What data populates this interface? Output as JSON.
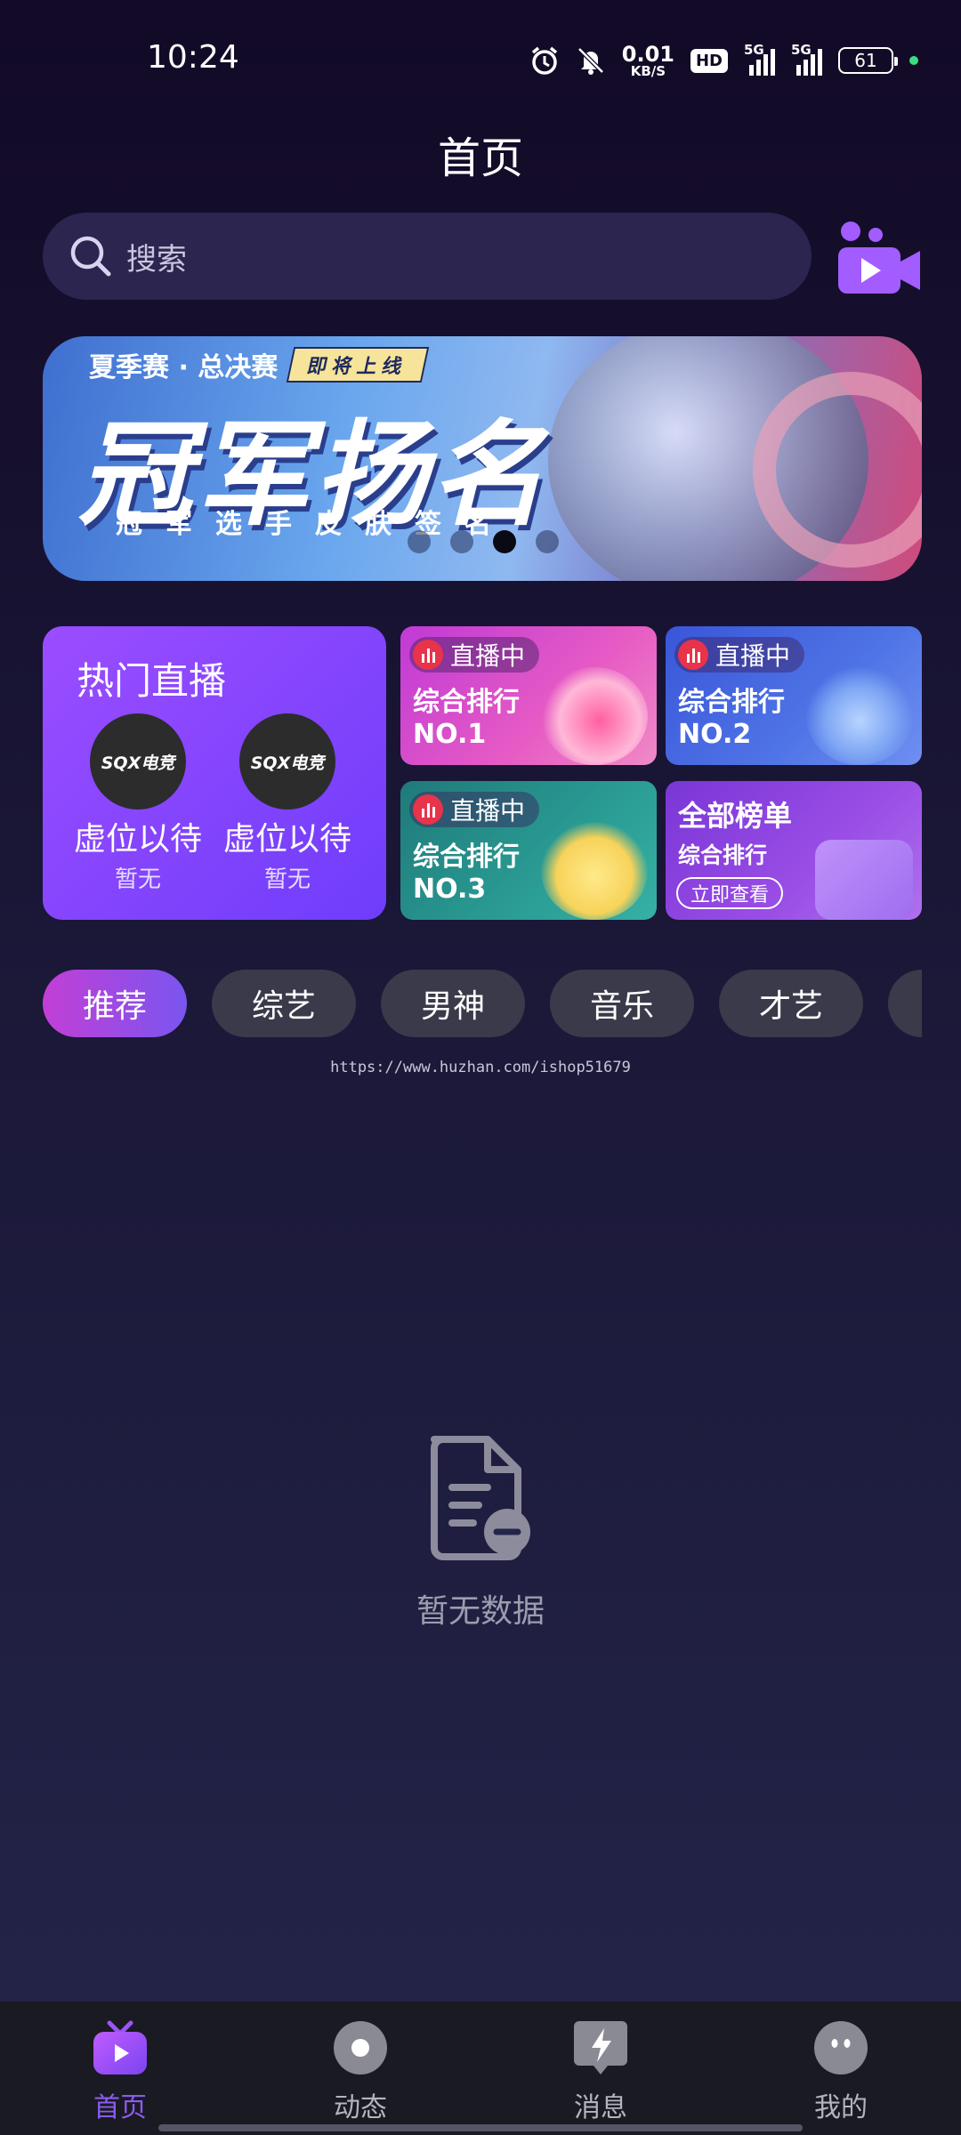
{
  "status_bar": {
    "time": "10:24",
    "net_speed_value": "0.01",
    "net_speed_unit": "KB/S",
    "hd_label": "HD",
    "signal1_label": "5G",
    "signal2_label": "5G",
    "battery": "61"
  },
  "header": {
    "title": "首页"
  },
  "search": {
    "placeholder": "搜索"
  },
  "banner": {
    "top_left": "夏季赛 · 总决赛",
    "tag": "即将上线",
    "headline": "冠军扬名",
    "subline": "冠军选手皮肤签名",
    "total_slides": 4,
    "active_slide": 3
  },
  "hot_live": {
    "title": "热门直播",
    "anchors": [
      {
        "avatar_text": "SQX电竞",
        "name": "虚位以待",
        "sub": "暂无"
      },
      {
        "avatar_text": "SQX电竞",
        "name": "虚位以待",
        "sub": "暂无"
      }
    ]
  },
  "rank_cards": [
    {
      "badge": "直播中",
      "title": "综合排行",
      "no": "NO.1"
    },
    {
      "badge": "直播中",
      "title": "综合排行",
      "no": "NO.2"
    },
    {
      "badge": "直播中",
      "title": "综合排行",
      "no": "NO.3"
    }
  ],
  "all_ranks": {
    "title": "全部榜单",
    "sub": "综合排行",
    "button": "立即查看"
  },
  "categories": [
    "推荐",
    "综艺",
    "男神",
    "音乐",
    "才艺",
    ""
  ],
  "active_category": 0,
  "watermark": "https://www.huzhan.com/ishop51679",
  "empty_state": {
    "text": "暂无数据"
  },
  "bottom_nav": [
    {
      "label": "首页",
      "icon": "tv-icon",
      "active": true
    },
    {
      "label": "动态",
      "icon": "record-icon",
      "active": false
    },
    {
      "label": "消息",
      "icon": "lightning-chat-icon",
      "active": false
    },
    {
      "label": "我的",
      "icon": "face-icon",
      "active": false
    }
  ],
  "colors": {
    "accent": "#8a5cf0",
    "live_red": "#e8334a",
    "tab_active_start": "#c23fd6",
    "tab_active_end": "#7a55f0"
  }
}
